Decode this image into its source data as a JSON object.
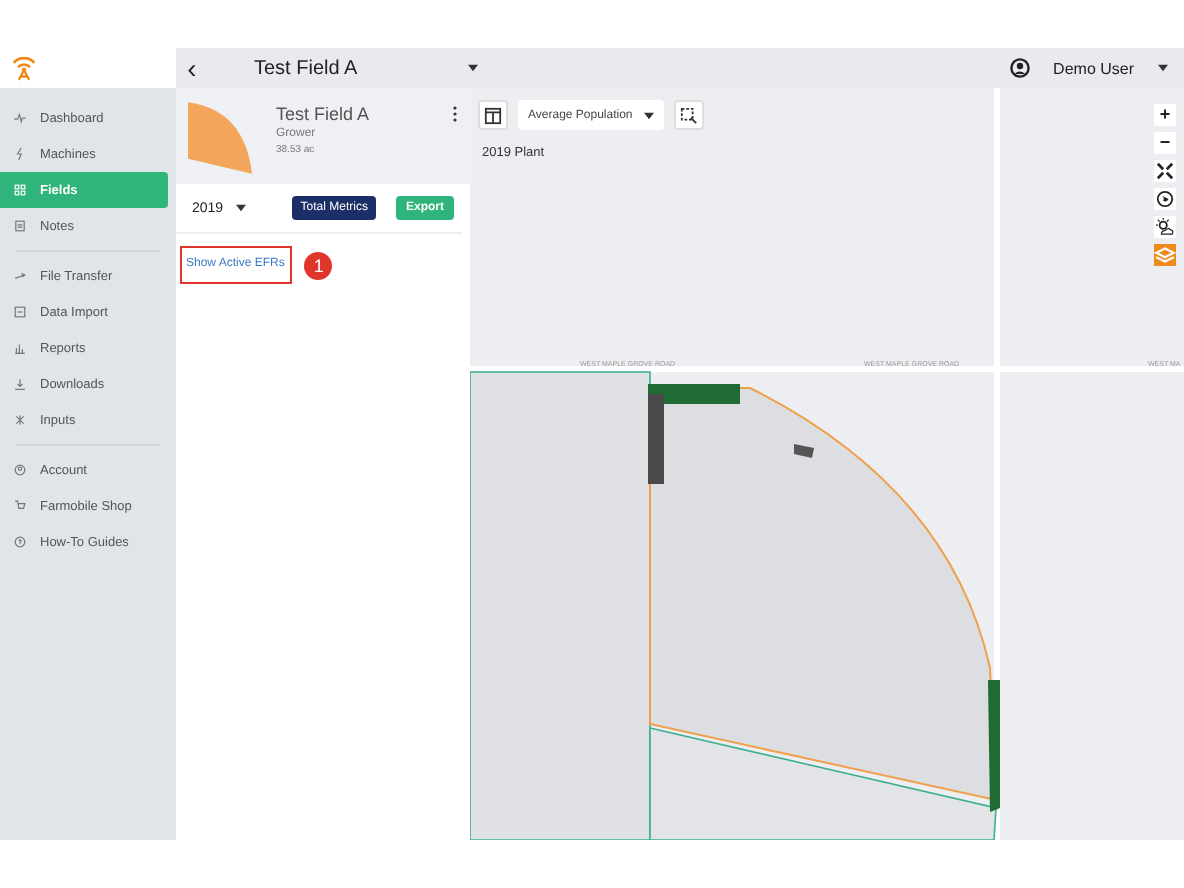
{
  "header": {
    "back": "‹",
    "field_title": "Test Field A",
    "user": "Demo User"
  },
  "sidebar": {
    "sections": [
      {
        "items": [
          {
            "label": "Dashboard",
            "selected": false
          },
          {
            "label": "Machines",
            "selected": false
          },
          {
            "label": "Fields",
            "selected": true
          },
          {
            "label": "Notes",
            "selected": false
          }
        ]
      },
      {
        "items": [
          {
            "label": "File Transfer",
            "selected": false
          },
          {
            "label": "Data Import",
            "selected": false
          },
          {
            "label": "Reports",
            "selected": false
          },
          {
            "label": "Downloads",
            "selected": false
          },
          {
            "label": "Inputs",
            "selected": false
          }
        ]
      },
      {
        "items": [
          {
            "label": "Account",
            "selected": false
          },
          {
            "label": "Farmobile Shop",
            "selected": false
          },
          {
            "label": "How-To Guides",
            "selected": false
          }
        ]
      }
    ]
  },
  "field_panel": {
    "name": "Test Field A",
    "owner": "Grower",
    "area": "38.53 ac",
    "year": "2019",
    "total_metrics": "Total Metrics",
    "export": "Export",
    "link": "Show Active EFRs",
    "callout": "1"
  },
  "map": {
    "layer": "Average Population",
    "caption": "2019 Plant",
    "road_labels": [
      "WEST MAPLE GROVE ROAD",
      "WEST MAPLE GROVE ROAD",
      "WEST MA"
    ],
    "zoom_in": "+",
    "zoom_out": "−"
  }
}
